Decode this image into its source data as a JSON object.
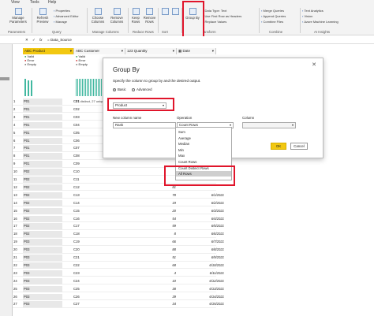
{
  "menu": [
    "View",
    "Tools",
    "Help"
  ],
  "ribbon": {
    "manage_parameters": "Manage Parameters",
    "refresh_preview": "Refresh Preview",
    "properties": "Properties",
    "advanced_editor": "Advanced Editor",
    "manage": "Manage",
    "choose_columns": "Choose Columns",
    "remove_columns": "Remove Columns",
    "keep_rows": "Keep Rows",
    "remove_rows": "Remove Rows",
    "group_by": "Group By",
    "data_type": "Data Type: Text",
    "first_row_headers": "Use First Row as Headers",
    "replace_values": "Replace Values",
    "merge_queries": "Merge Queries",
    "append_queries": "Append Queries",
    "combine_files": "Combine Files",
    "text_analytics": "Text Analytics",
    "vision": "Vision",
    "azure_ml": "Azure Machine Learning",
    "groups": {
      "parameters": "Parameters",
      "query": "Query",
      "manage_columns": "Manage Columns",
      "reduce_rows": "Reduce Rows",
      "sort": "Sort",
      "transform": "ansform",
      "combine": "Combine",
      "ai_insights": "AI Insights"
    }
  },
  "formula": {
    "fx": "fx",
    "text": "= Data_Source"
  },
  "columns": {
    "product": "Product",
    "customer": "Customer",
    "quantity": "Quantity",
    "date": "Date"
  },
  "profile": {
    "valid": "Valid",
    "error": "Error",
    "empty": "Empty",
    "product_distinct": "3 distinct, 0 unique",
    "customer_distinct": "27 distinct, 27 unique"
  },
  "rows": [
    {
      "n": "1",
      "p": "P01",
      "c": "C01",
      "q": "",
      "d": ""
    },
    {
      "n": "2",
      "p": "P01",
      "c": "C02",
      "q": "",
      "d": ""
    },
    {
      "n": "3",
      "p": "P01",
      "c": "C03",
      "q": "",
      "d": ""
    },
    {
      "n": "4",
      "p": "P01",
      "c": "C04",
      "q": "",
      "d": ""
    },
    {
      "n": "5",
      "p": "P01",
      "c": "C05",
      "q": "",
      "d": ""
    },
    {
      "n": "6",
      "p": "P01",
      "c": "C06",
      "q": "",
      "d": ""
    },
    {
      "n": "7",
      "p": "P01",
      "c": "C07",
      "q": "",
      "d": ""
    },
    {
      "n": "8",
      "p": "P01",
      "c": "C08",
      "q": "",
      "d": ""
    },
    {
      "n": "9",
      "p": "P01",
      "c": "C09",
      "q": "",
      "d": ""
    },
    {
      "n": "10",
      "p": "P02",
      "c": "C10",
      "q": "",
      "d": ""
    },
    {
      "n": "11",
      "p": "P02",
      "c": "C11",
      "q": "",
      "d": ""
    },
    {
      "n": "12",
      "p": "P02",
      "c": "C12",
      "q": "81",
      "d": ""
    },
    {
      "n": "13",
      "p": "P02",
      "c": "C13",
      "q": "78",
      "d": "6/1/2021"
    },
    {
      "n": "14",
      "p": "P02",
      "c": "C14",
      "q": "19",
      "d": "6/2/2021"
    },
    {
      "n": "15",
      "p": "P02",
      "c": "C15",
      "q": "20",
      "d": "6/3/2021"
    },
    {
      "n": "16",
      "p": "P02",
      "c": "C16",
      "q": "54",
      "d": "6/4/2021"
    },
    {
      "n": "17",
      "p": "P02",
      "c": "C17",
      "q": "59",
      "d": "6/5/2021"
    },
    {
      "n": "18",
      "p": "P02",
      "c": "C18",
      "q": "8",
      "d": "6/6/2021"
    },
    {
      "n": "19",
      "p": "P03",
      "c": "C19",
      "q": "66",
      "d": "6/7/2021"
    },
    {
      "n": "20",
      "p": "P03",
      "c": "C20",
      "q": "88",
      "d": "6/8/2021"
    },
    {
      "n": "21",
      "p": "P03",
      "c": "C21",
      "q": "51",
      "d": "6/9/2021"
    },
    {
      "n": "22",
      "p": "P03",
      "c": "C22",
      "q": "68",
      "d": "6/10/2021"
    },
    {
      "n": "23",
      "p": "P03",
      "c": "C23",
      "q": "4",
      "d": "6/11/2021"
    },
    {
      "n": "24",
      "p": "P03",
      "c": "C24",
      "q": "10",
      "d": "6/12/2021"
    },
    {
      "n": "25",
      "p": "P03",
      "c": "C25",
      "q": "38",
      "d": "6/13/2021"
    },
    {
      "n": "26",
      "p": "P03",
      "c": "C26",
      "q": "39",
      "d": "6/14/2021"
    },
    {
      "n": "27",
      "p": "P03",
      "c": "C27",
      "q": "34",
      "d": "6/15/2021"
    }
  ],
  "dialog": {
    "title": "Group By",
    "close": "✕",
    "description": "Specify the column to group by and the desired output.",
    "basic": "Basic",
    "advanced": "Advanced",
    "group_column": "Product",
    "new_column_name_label": "New column name",
    "new_column_name": "Rank",
    "operation_label": "Operation",
    "operation": "Count Rows",
    "column_label": "Column",
    "column_value": "",
    "ok": "OK",
    "cancel": "Cancel"
  },
  "operations": [
    "Sum",
    "Average",
    "Median",
    "Min",
    "Max",
    "Count Rows",
    "Count Distinct Rows",
    "All Rows"
  ],
  "highlight_color": "#e0152b"
}
